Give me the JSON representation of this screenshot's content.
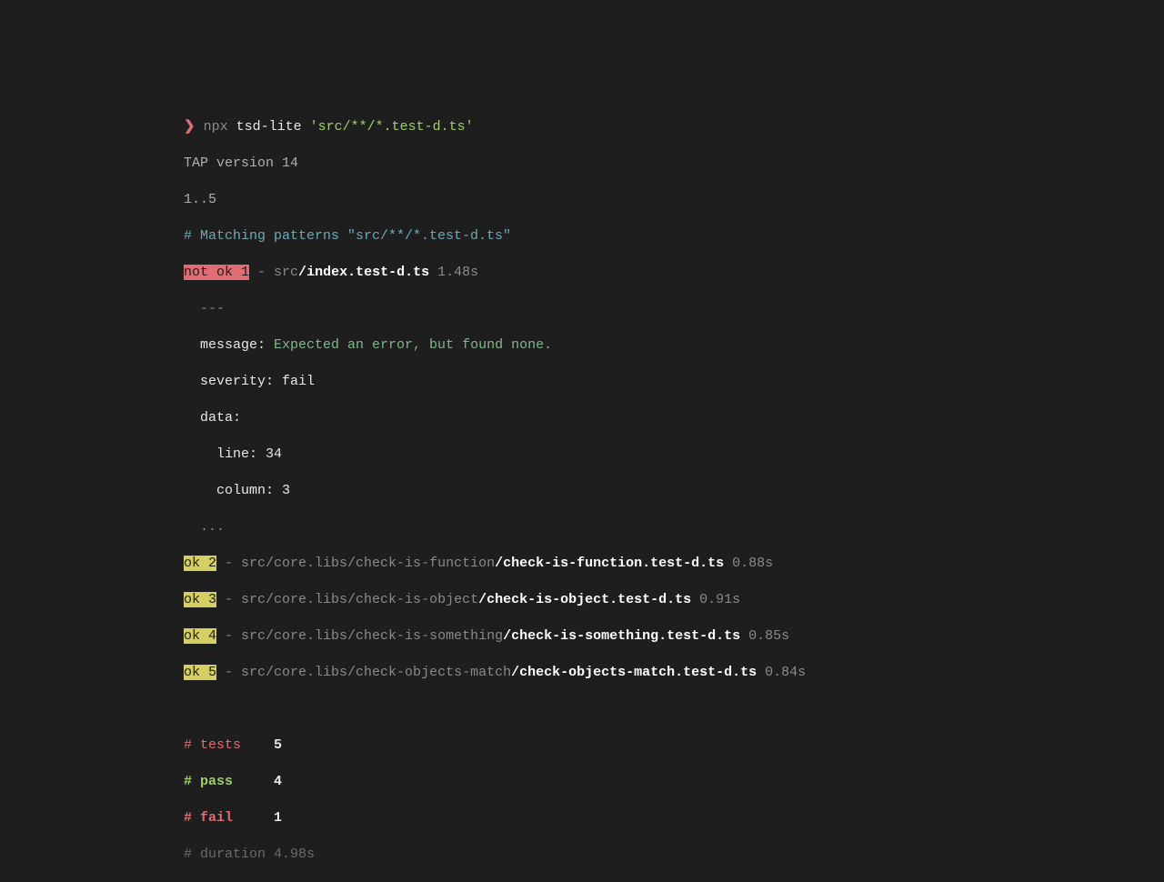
{
  "prompt": {
    "symbol": "❯",
    "npx": "npx",
    "cmd": "tsd-lite",
    "arg": "'src/**/*.test-d.ts'"
  },
  "tap": {
    "version": "TAP version 14",
    "plan": "1..5"
  },
  "matching": "# Matching patterns \"src/**/*.test-d.ts\"",
  "fail": {
    "tag": "not ok 1",
    "sep": " - ",
    "dir": "src",
    "slash": "/",
    "file": "index.test-d.ts",
    "time": "1.48s",
    "dash1": "  ---",
    "msgLabel": "  message: ",
    "msg": "Expected an error, but found none.",
    "sev": "  severity: fail",
    "data": "  data:",
    "line": "    line: 34",
    "col": "    column: 3",
    "dash2": "  ..."
  },
  "pass": [
    {
      "tag": "ok 2",
      "sep": " - ",
      "dir": "src/core.libs/check-is-function",
      "slash": "/",
      "file": "check-is-function.test-d.ts",
      "time": "0.88s"
    },
    {
      "tag": "ok 3",
      "sep": " - ",
      "dir": "src/core.libs/check-is-object",
      "slash": "/",
      "file": "check-is-object.test-d.ts",
      "time": "0.91s"
    },
    {
      "tag": "ok 4",
      "sep": " - ",
      "dir": "src/core.libs/check-is-something",
      "slash": "/",
      "file": "check-is-something.test-d.ts",
      "time": "0.85s"
    },
    {
      "tag": "ok 5",
      "sep": " - ",
      "dir": "src/core.libs/check-objects-match",
      "slash": "/",
      "file": "check-objects-match.test-d.ts",
      "time": "0.84s"
    }
  ],
  "summary": {
    "testsLabel": "# tests    ",
    "testsVal": "5",
    "passLabel": "# pass     ",
    "passVal": "4",
    "failLabel": "# fail     ",
    "failVal": "1",
    "duration": "# duration 4.98s"
  }
}
